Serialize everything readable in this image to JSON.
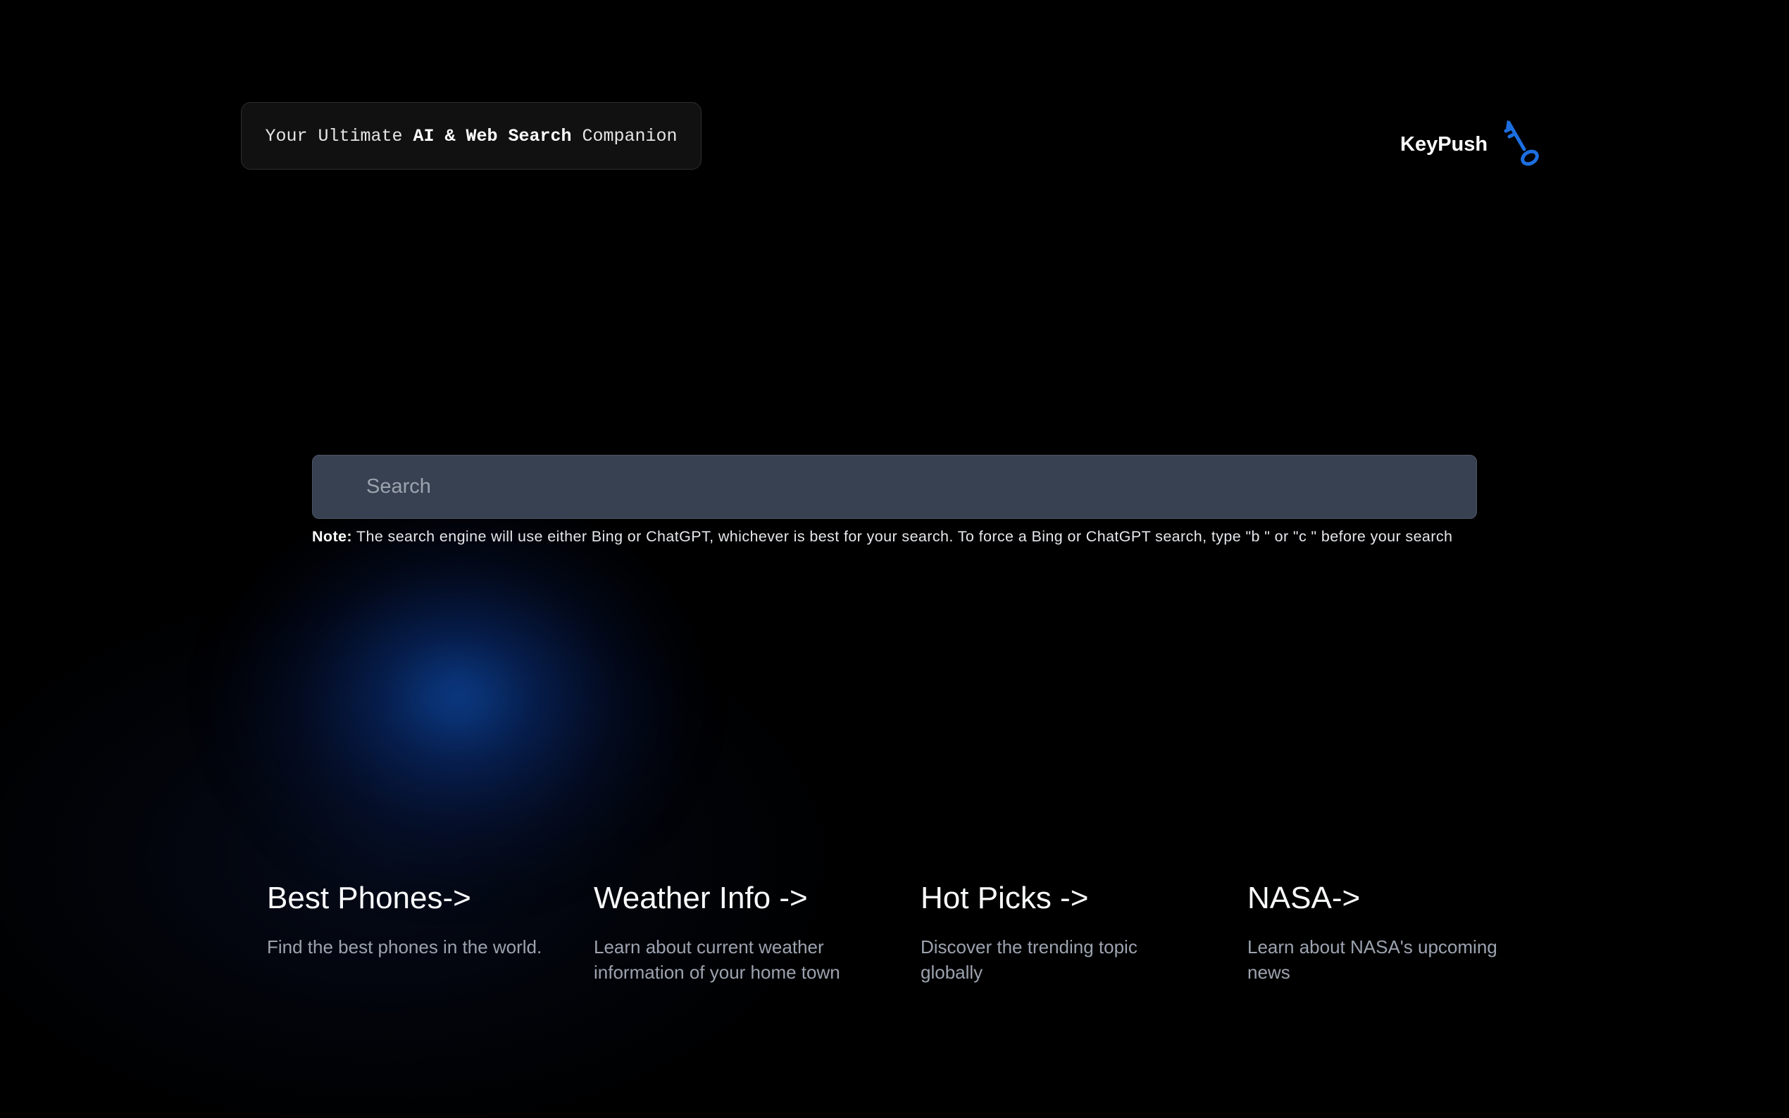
{
  "header": {
    "tagline_prefix": "Your Ultimate ",
    "tagline_bold": "AI & Web Search",
    "tagline_suffix": " Companion",
    "brand_name": "KeyPush",
    "brand_icon": "key-icon"
  },
  "search": {
    "placeholder": "Search",
    "value": ""
  },
  "note": {
    "label": "Note:",
    "text": " The search engine will use either Bing or ChatGPT, whichever is best for your search. To force a Bing or ChatGPT search, type \"b \" or \"c \" before your search"
  },
  "cards": [
    {
      "title": "Best Phones->",
      "description": "Find the best phones in the world."
    },
    {
      "title": "Weather Info ->",
      "description": "Learn about current weather information of your home town"
    },
    {
      "title": "Hot Picks ->",
      "description": "Discover the trending topic globally"
    },
    {
      "title": "NASA->",
      "description": "Learn about NASA's upcoming news"
    }
  ],
  "colors": {
    "background": "#000000",
    "search_bg": "#374151",
    "accent_blue": "#1d6fe0",
    "muted_text": "#9ca3af"
  }
}
